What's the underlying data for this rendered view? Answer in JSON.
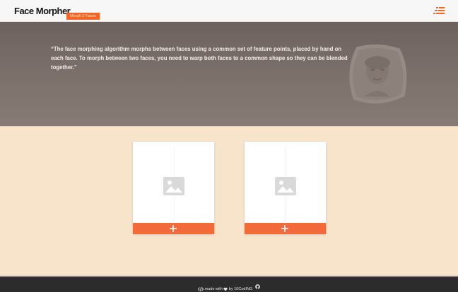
{
  "header": {
    "title": "Face Morpher",
    "badge": "Morph 2 Faces",
    "menu_icon": "menu-list-icon"
  },
  "hero": {
    "quote": "“The face morphing algorithm morphs between faces using a common set of feature points, placed by hand on each face. To morph between two faces, you need to warp both faces to a common shape so they can be blended together.”"
  },
  "uploaders": [
    {
      "icon": "image-placeholder-icon",
      "button_icon": "plus-icon"
    },
    {
      "icon": "image-placeholder-icon",
      "button_icon": "plus-icon"
    }
  ],
  "colors": {
    "accent": "#f26a3a",
    "background": "#f7e4cb",
    "hero": "#7a6e69",
    "footer": "#2c2c2c"
  },
  "footer": {
    "made_with": "made with",
    "by": "by 10CodING"
  }
}
